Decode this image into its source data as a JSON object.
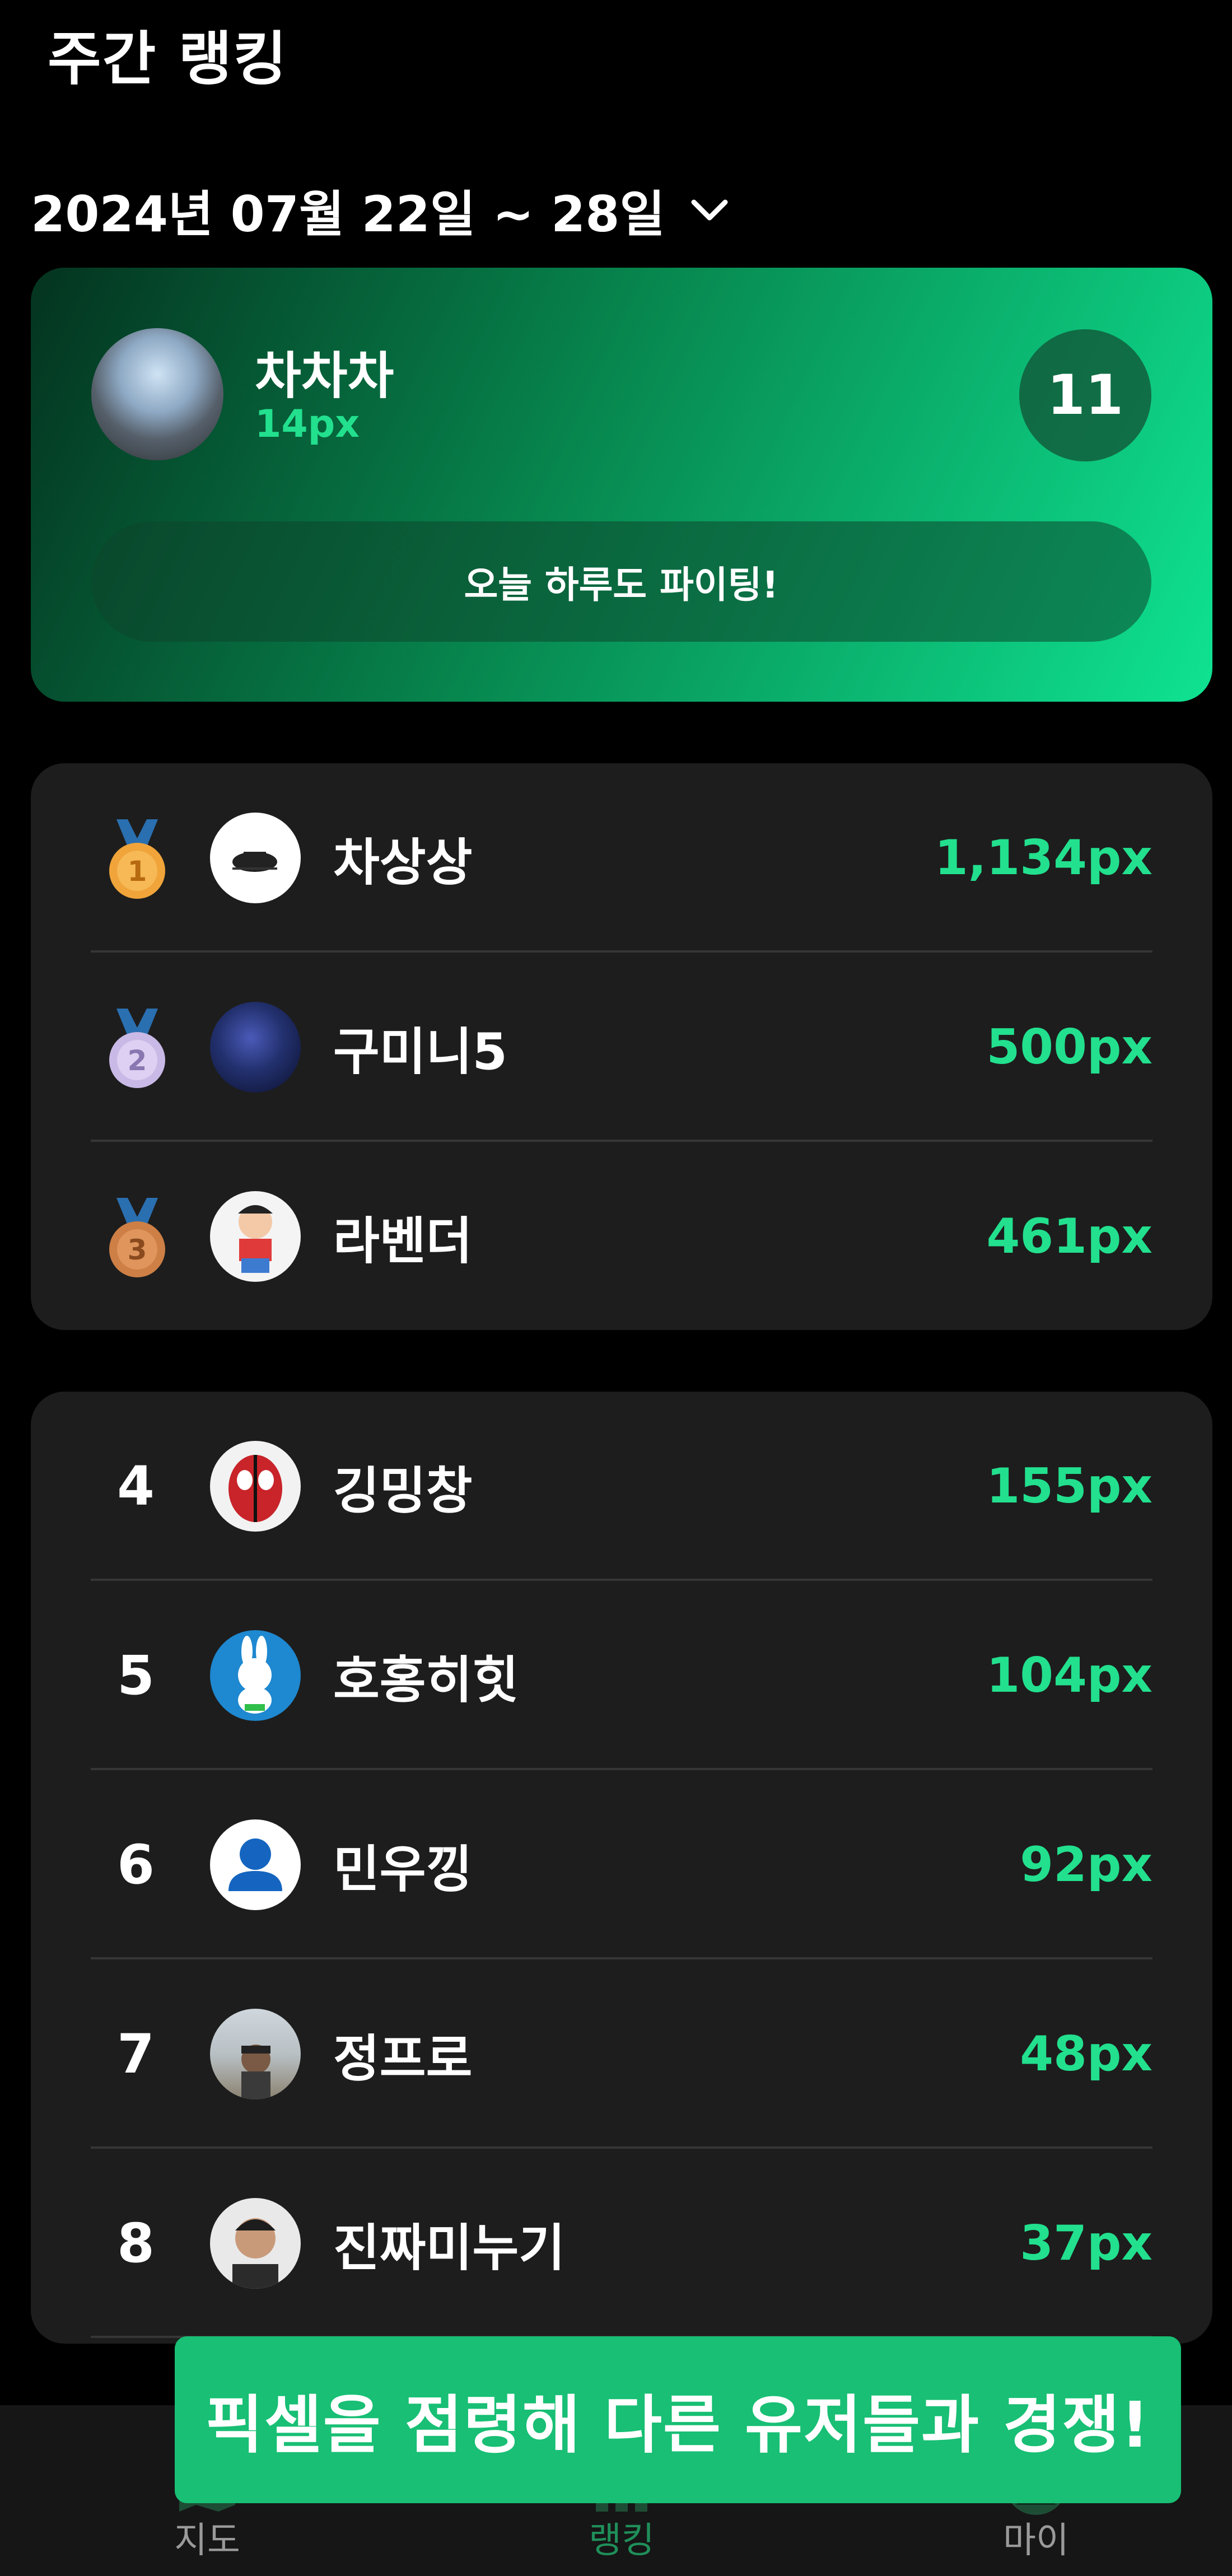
{
  "header": {
    "title": "주간 랭킹"
  },
  "date_range": {
    "label": "2024년 07월 22일 ~ 28일",
    "icon": "chevron-down-icon"
  },
  "my_rank": {
    "name": "차차차",
    "score": "14px",
    "rank": "11",
    "cheer_text": "오늘 하루도 파이팅!"
  },
  "top3": [
    {
      "medal": "1",
      "name": "차상상",
      "score": "1,134px",
      "medal_color": "#f0a43a"
    },
    {
      "medal": "2",
      "name": "구미니5",
      "score": "500px",
      "medal_color": "#c9b9e6"
    },
    {
      "medal": "3",
      "name": "라벤더",
      "score": "461px",
      "medal_color": "#cd7f46"
    }
  ],
  "ranking": [
    {
      "rank": "4",
      "name": "깅밍창",
      "score": "155px"
    },
    {
      "rank": "5",
      "name": "호홍히힛",
      "score": "104px"
    },
    {
      "rank": "6",
      "name": "민우낑",
      "score": "92px"
    },
    {
      "rank": "7",
      "name": "정프로",
      "score": "48px"
    },
    {
      "rank": "8",
      "name": "진짜미누기",
      "score": "37px"
    }
  ],
  "toast": {
    "text": "픽셀을 점령해 다른 유저들과 경쟁!"
  },
  "nav": [
    {
      "label": "지도",
      "icon": "map-icon",
      "active": false
    },
    {
      "label": "랭킹",
      "icon": "bar-chart-icon",
      "active": true
    },
    {
      "label": "마이",
      "icon": "profile-icon",
      "active": false
    }
  ],
  "colors": {
    "accent": "#22e08e",
    "card_bg": "#1d1d1d",
    "toast_bg": "#18bf74"
  }
}
